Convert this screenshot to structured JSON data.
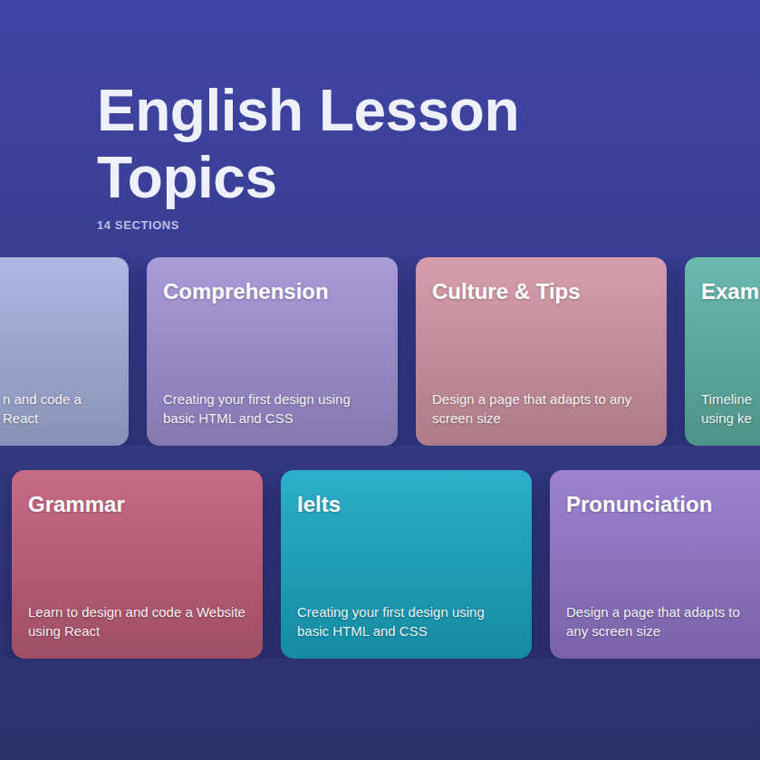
{
  "header": {
    "title": "English Lesson Topics",
    "subtitle": "14 SECTIONS"
  },
  "rows": [
    {
      "cards": [
        {
          "description": "n and code a React",
          "color": "#a7b2de"
        },
        {
          "title": "Comprehension",
          "description": "Creating your first design using basic HTML and CSS",
          "color": "#a393d6"
        },
        {
          "title": "Culture & Tips",
          "description": "Design a page that adapts to any screen size",
          "color": "#d396a6"
        },
        {
          "title": "Exam",
          "description": "Timeline using ke",
          "color": "#5fb3a8"
        }
      ]
    },
    {
      "cards": [
        {
          "title": "Grammar",
          "description": "Learn to design and code a Website using React",
          "color": "#c25f7c"
        },
        {
          "title": "Ielts",
          "description": "Creating your first design using basic HTML and CSS",
          "color": "#1aa9c4"
        },
        {
          "title": "Pronunciation",
          "description": "Design a page that adapts to any screen size",
          "color": "#9478cc"
        }
      ]
    }
  ]
}
